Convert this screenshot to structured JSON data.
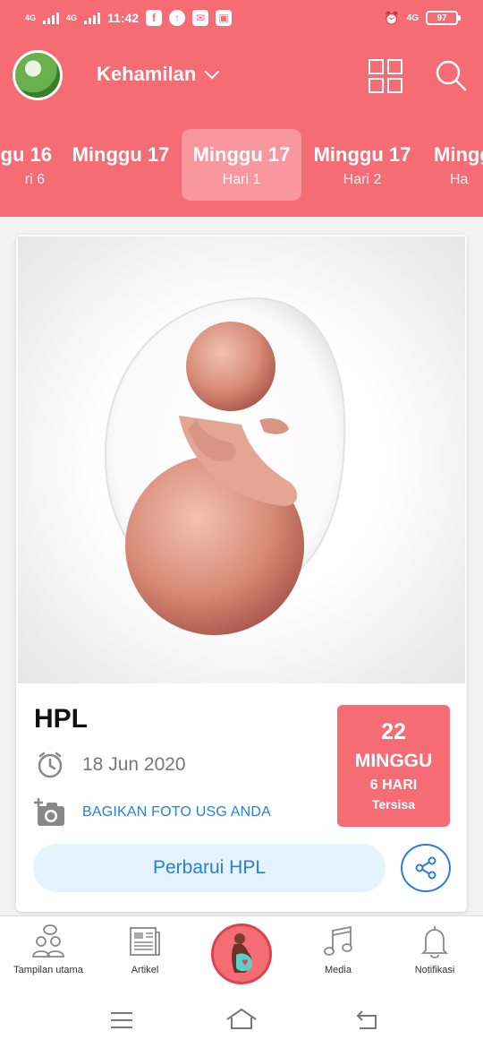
{
  "statusbar": {
    "net1": "4G",
    "net2": "4G",
    "time": "11:42",
    "net3": "4G",
    "battery": "97"
  },
  "topbar": {
    "title": "Kehamilan"
  },
  "tabs": [
    {
      "week": "gu 16",
      "day": "ri 6"
    },
    {
      "week": "Minggu 17",
      "day": ""
    },
    {
      "week": "Minggu 17",
      "day": "Hari 1"
    },
    {
      "week": "Minggu 17",
      "day": "Hari 2"
    },
    {
      "week": "Mingg",
      "day": "Ha"
    }
  ],
  "card": {
    "heading": "HPL",
    "date": "18 Jun 2020",
    "share_photo": "BAGIKAN FOTO USG ANDA",
    "countdown": {
      "number": "22",
      "weeks_label": "MINGGU",
      "days": "6 HARI",
      "remaining": "Tersisa"
    },
    "update_button": "Perbarui HPL"
  },
  "bottom_nav": [
    {
      "label": "Tampilan utama",
      "icon": "people-icon"
    },
    {
      "label": "Artikel",
      "icon": "article-icon"
    },
    {
      "label": "",
      "icon": "pregnancy-icon"
    },
    {
      "label": "Media",
      "icon": "music-icon"
    },
    {
      "label": "Notifikasi",
      "icon": "bell-icon"
    }
  ],
  "colors": {
    "brand": "#f56c75",
    "link": "#2a7fd4",
    "button_bg": "#e5f3fc"
  }
}
